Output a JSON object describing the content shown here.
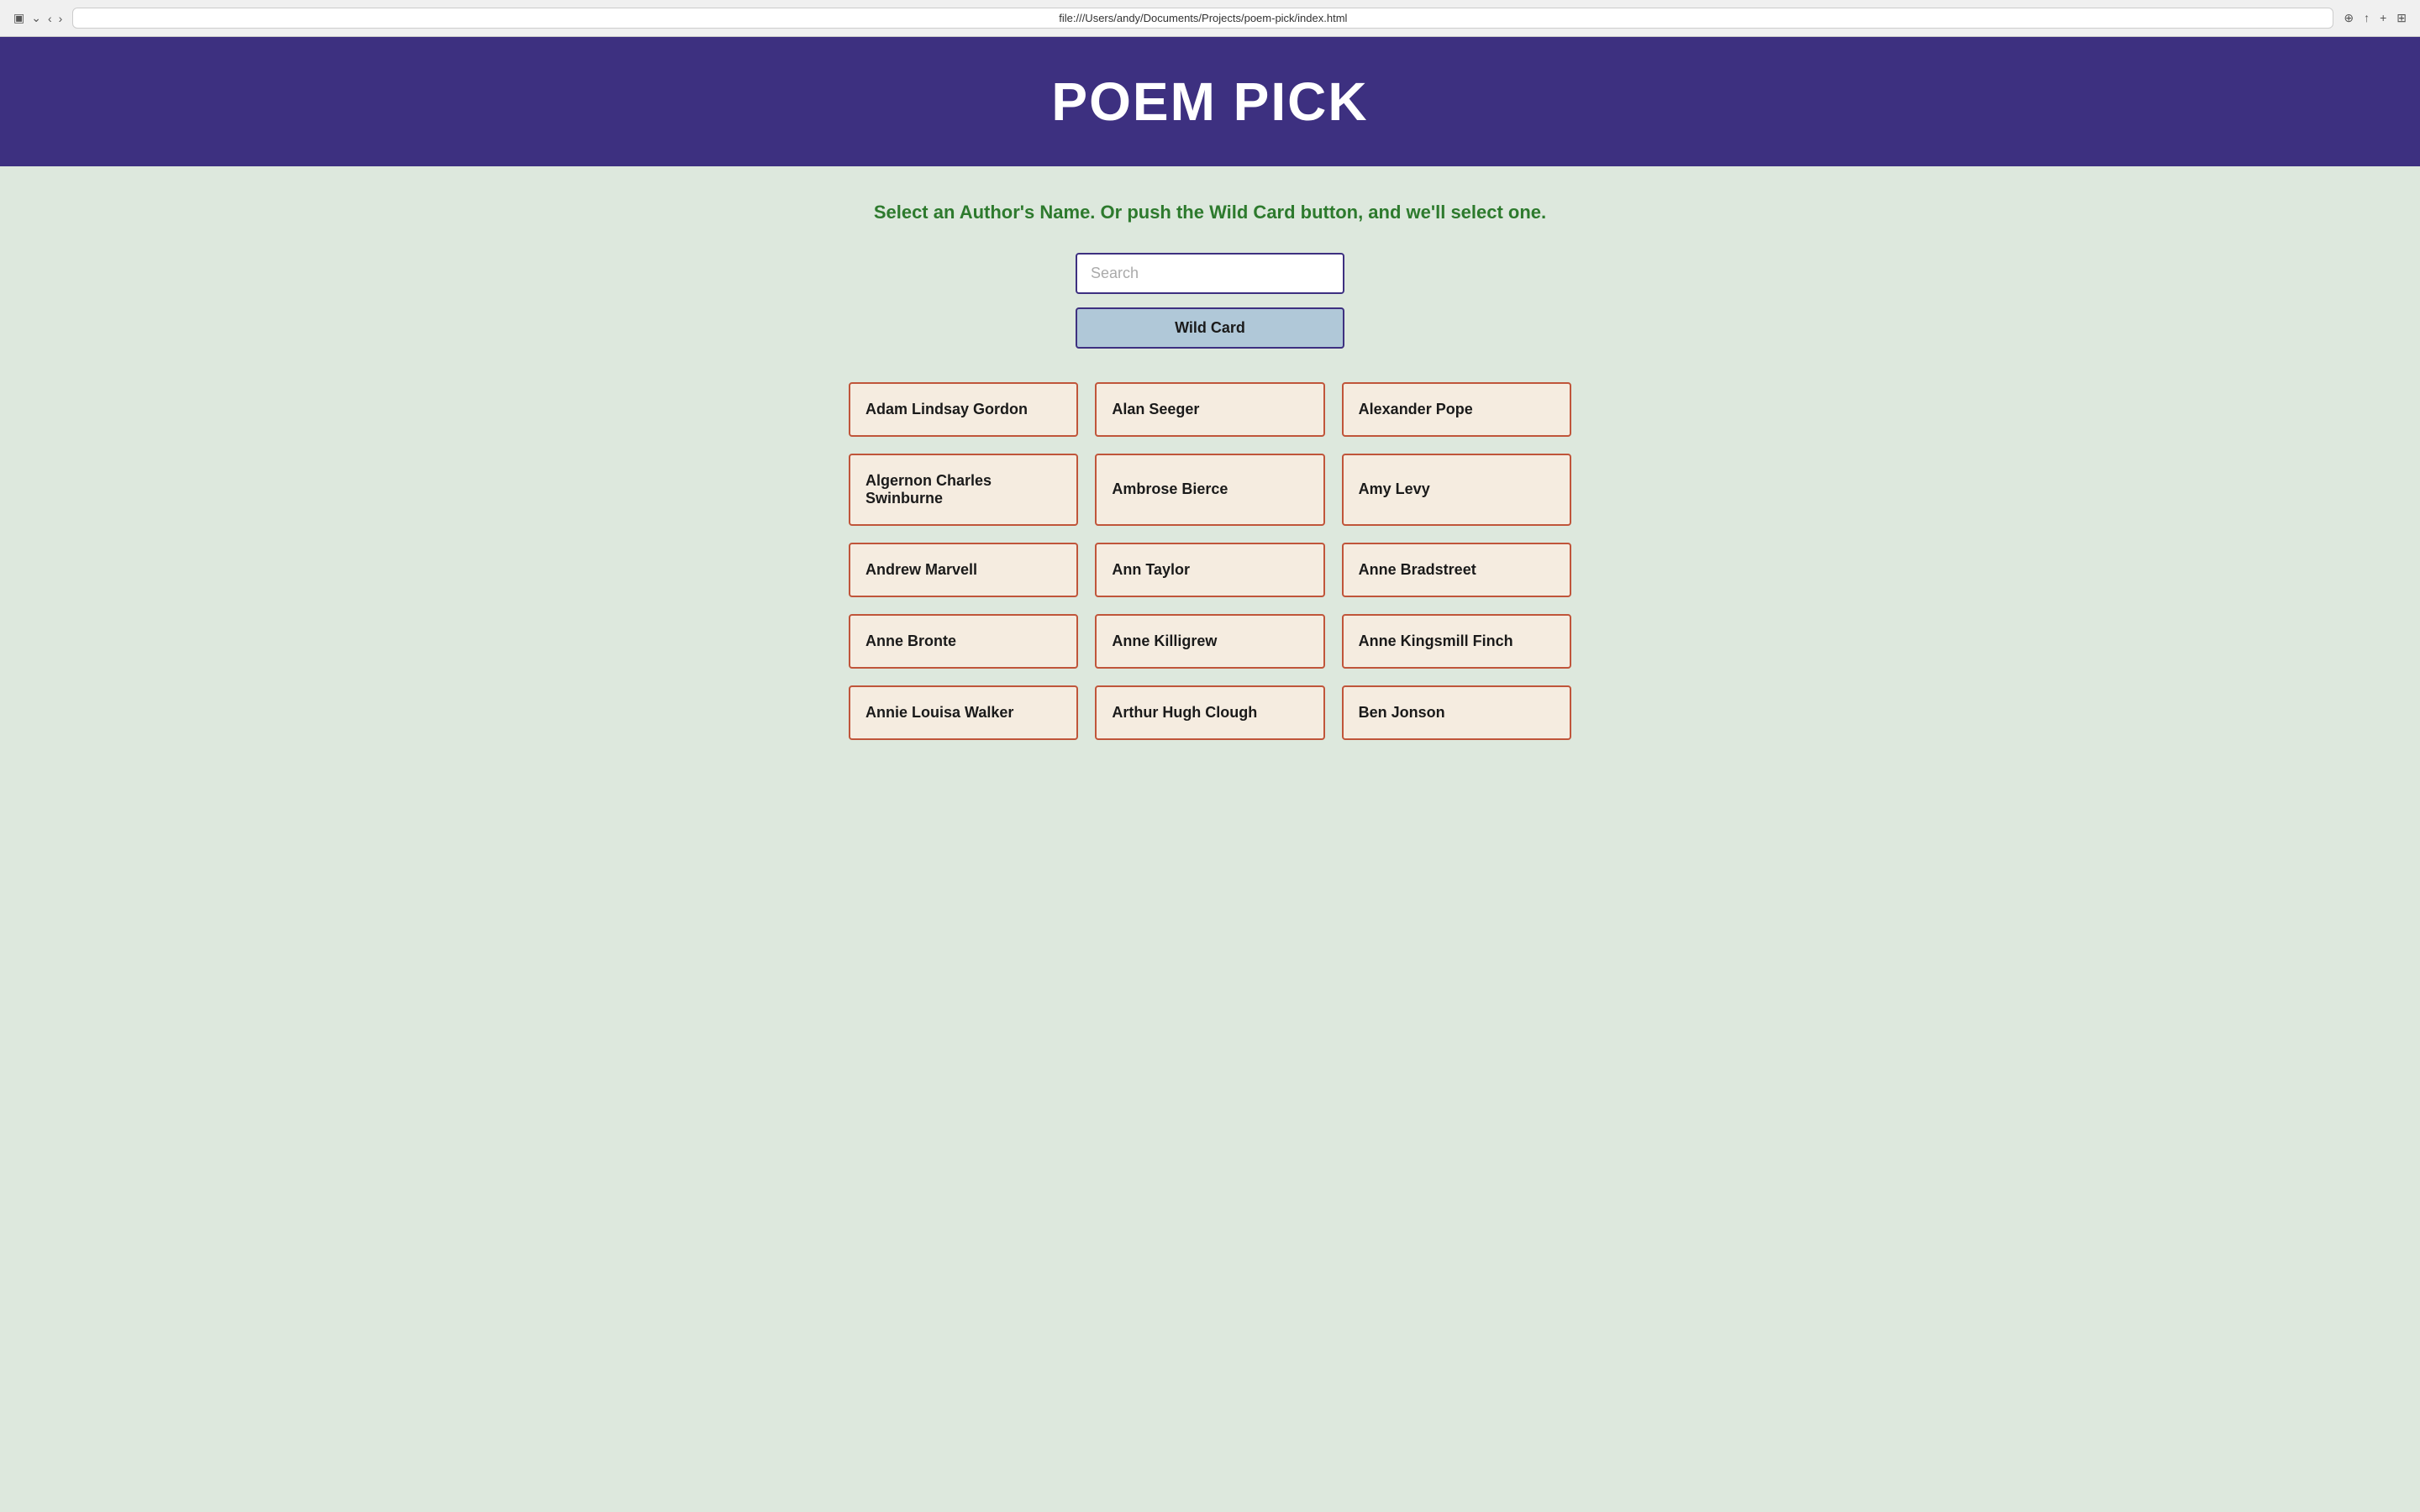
{
  "browser": {
    "address": "file:///Users/andy/Documents/Projects/poem-pick/index.html"
  },
  "header": {
    "title": "POEM PICK"
  },
  "subtitle": "Select an Author's Name. Or push the Wild Card button, and we'll select one.",
  "search": {
    "placeholder": "Search"
  },
  "wildcard": {
    "label": "Wild Card"
  },
  "authors": [
    "Adam Lindsay Gordon",
    "Alan Seeger",
    "Alexander Pope",
    "Algernon Charles Swinburne",
    "Ambrose Bierce",
    "Amy Levy",
    "Andrew Marvell",
    "Ann Taylor",
    "Anne Bradstreet",
    "Anne Bronte",
    "Anne Killigrew",
    "Anne Kingsmill Finch",
    "Annie Louisa Walker",
    "Arthur Hugh Clough",
    "Ben Jonson"
  ]
}
